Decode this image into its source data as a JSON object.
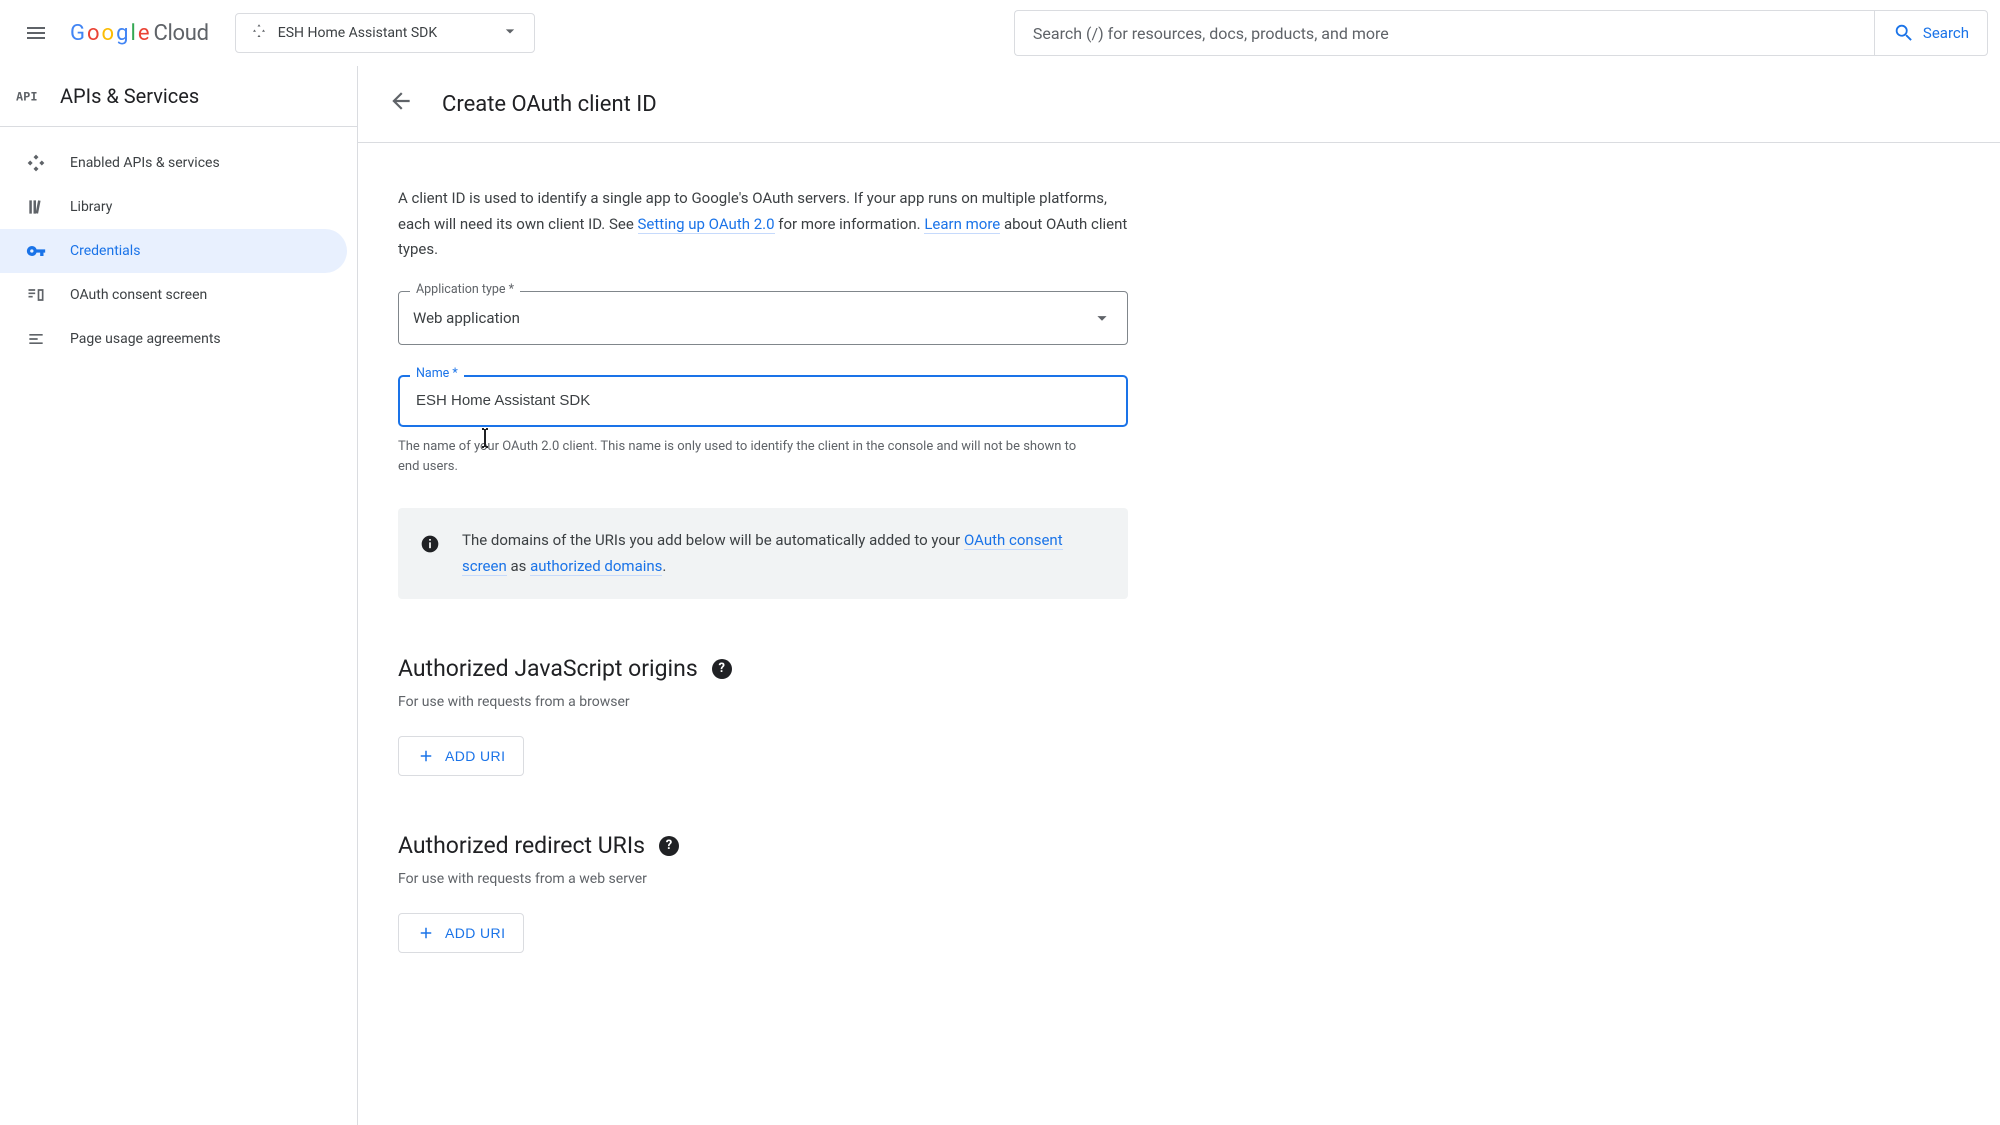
{
  "header": {
    "logo_word": "Cloud",
    "project_name": "ESH Home Assistant SDK",
    "search_placeholder": "Search (/) for resources, docs, products, and more",
    "search_button": "Search"
  },
  "sidebar": {
    "title": "APIs & Services",
    "items": [
      {
        "label": "Enabled APIs & services",
        "icon": "enabled"
      },
      {
        "label": "Library",
        "icon": "library"
      },
      {
        "label": "Credentials",
        "icon": "key",
        "selected": true
      },
      {
        "label": "OAuth consent screen",
        "icon": "consent"
      },
      {
        "label": "Page usage agreements",
        "icon": "agreements"
      }
    ]
  },
  "page": {
    "title": "Create OAuth client ID",
    "intro_pre": "A client ID is used to identify a single app to Google's OAuth servers. If your app runs on multiple platforms, each will need its own client ID. See ",
    "intro_link1": "Setting up OAuth 2.0",
    "intro_mid": " for more information. ",
    "intro_link2": "Learn more",
    "intro_post": " about OAuth client types.",
    "app_type_label": "Application type *",
    "app_type_value": "Web application",
    "name_label": "Name *",
    "name_value": "ESH Home Assistant SDK",
    "name_helper": "The name of your OAuth 2.0 client. This name is only used to identify the client in the console and will not be shown to end users.",
    "info_pre": "The domains of the URIs you add below will be automatically added to your ",
    "info_link1": "OAuth consent screen",
    "info_mid": " as ",
    "info_link2": "authorized domains",
    "info_post": ".",
    "sections": {
      "js": {
        "title": "Authorized JavaScript origins",
        "sub": "For use with requests from a browser",
        "add": "ADD URI"
      },
      "redirect": {
        "title": "Authorized redirect URIs",
        "sub": "For use with requests from a web server",
        "add": "ADD URI"
      }
    }
  }
}
